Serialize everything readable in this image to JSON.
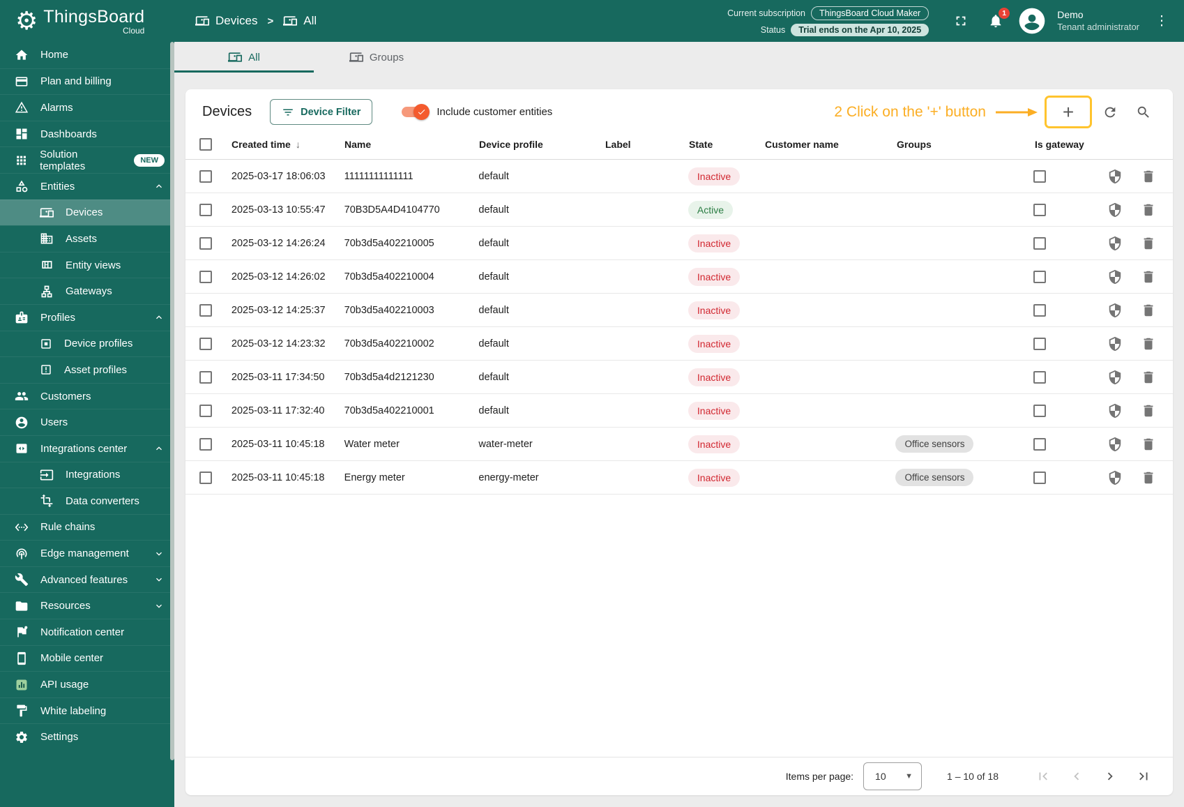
{
  "header": {
    "logo_title": "ThingsBoard",
    "logo_subtitle": "Cloud",
    "breadcrumb": [
      {
        "label": "Devices"
      },
      {
        "label": "All"
      }
    ],
    "subscription_label": "Current subscription",
    "subscription_value": "ThingsBoard Cloud Maker",
    "status_label": "Status",
    "status_value": "Trial ends on the Apr 10, 2025",
    "notification_count": "1",
    "user_name": "Demo",
    "user_role": "Tenant administrator"
  },
  "sidebar": {
    "items": [
      {
        "label": "Home"
      },
      {
        "label": "Plan and billing"
      },
      {
        "label": "Alarms"
      },
      {
        "label": "Dashboards"
      },
      {
        "label": "Solution templates",
        "badge": "NEW"
      },
      {
        "label": "Entities"
      },
      {
        "label": "Devices"
      },
      {
        "label": "Assets"
      },
      {
        "label": "Entity views"
      },
      {
        "label": "Gateways"
      },
      {
        "label": "Profiles"
      },
      {
        "label": "Device profiles"
      },
      {
        "label": "Asset profiles"
      },
      {
        "label": "Customers"
      },
      {
        "label": "Users"
      },
      {
        "label": "Integrations center"
      },
      {
        "label": "Integrations"
      },
      {
        "label": "Data converters"
      },
      {
        "label": "Rule chains"
      },
      {
        "label": "Edge management"
      },
      {
        "label": "Advanced features"
      },
      {
        "label": "Resources"
      },
      {
        "label": "Notification center"
      },
      {
        "label": "Mobile center"
      },
      {
        "label": "API usage"
      },
      {
        "label": "White labeling"
      },
      {
        "label": "Settings"
      }
    ]
  },
  "tabs": [
    {
      "label": "All"
    },
    {
      "label": "Groups"
    }
  ],
  "toolbar": {
    "title": "Devices",
    "filter_button": "Device Filter",
    "toggle_label": "Include customer entities",
    "plus_label": "+"
  },
  "annotation": {
    "text": "2 Click on the '+' button"
  },
  "table": {
    "columns": [
      "Created time",
      "Name",
      "Device profile",
      "Label",
      "State",
      "Customer name",
      "Groups",
      "Is gateway"
    ],
    "sort_arrow": "↓",
    "rows": [
      {
        "created_time": "2025-03-17 18:06:03",
        "name": "11111111111111",
        "device_profile": "default",
        "label": "",
        "state": "Inactive",
        "customer_name": "",
        "groups": ""
      },
      {
        "created_time": "2025-03-13 10:55:47",
        "name": "70B3D5A4D4104770",
        "device_profile": "default",
        "label": "",
        "state": "Active",
        "customer_name": "",
        "groups": ""
      },
      {
        "created_time": "2025-03-12 14:26:24",
        "name": "70b3d5a402210005",
        "device_profile": "default",
        "label": "",
        "state": "Inactive",
        "customer_name": "",
        "groups": ""
      },
      {
        "created_time": "2025-03-12 14:26:02",
        "name": "70b3d5a402210004",
        "device_profile": "default",
        "label": "",
        "state": "Inactive",
        "customer_name": "",
        "groups": ""
      },
      {
        "created_time": "2025-03-12 14:25:37",
        "name": "70b3d5a402210003",
        "device_profile": "default",
        "label": "",
        "state": "Inactive",
        "customer_name": "",
        "groups": ""
      },
      {
        "created_time": "2025-03-12 14:23:32",
        "name": "70b3d5a402210002",
        "device_profile": "default",
        "label": "",
        "state": "Inactive",
        "customer_name": "",
        "groups": ""
      },
      {
        "created_time": "2025-03-11 17:34:50",
        "name": "70b3d5a4d2121230",
        "device_profile": "default",
        "label": "",
        "state": "Inactive",
        "customer_name": "",
        "groups": ""
      },
      {
        "created_time": "2025-03-11 17:32:40",
        "name": "70b3d5a402210001",
        "device_profile": "default",
        "label": "",
        "state": "Inactive",
        "customer_name": "",
        "groups": ""
      },
      {
        "created_time": "2025-03-11 10:45:18",
        "name": "Water meter",
        "device_profile": "water-meter",
        "label": "",
        "state": "Inactive",
        "customer_name": "",
        "groups": "Office sensors"
      },
      {
        "created_time": "2025-03-11 10:45:18",
        "name": "Energy meter",
        "device_profile": "energy-meter",
        "label": "",
        "state": "Inactive",
        "customer_name": "",
        "groups": "Office sensors"
      }
    ]
  },
  "pagination": {
    "items_per_page_label": "Items per page:",
    "items_per_page": "10",
    "range": "1 – 10 of 18"
  },
  "colors": {
    "brand_teal": "#17695E",
    "toggle_orange": "#F45B2E",
    "annotation_amber": "#FBAE24",
    "state_inactive": "#D12730",
    "state_active": "#2B7D44"
  }
}
